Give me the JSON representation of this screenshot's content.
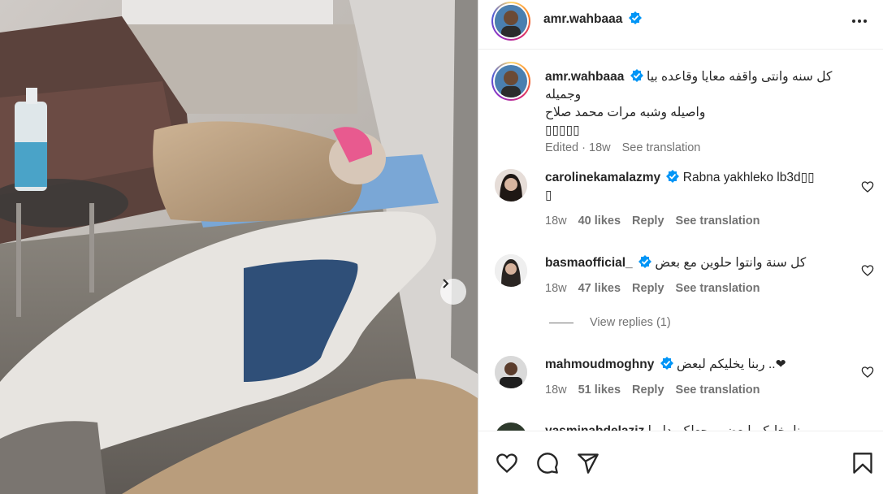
{
  "post": {
    "username": "amr.wahbaaa",
    "caption_line1": "كل سنه وانتى واقفه معايا وقاعده بيا وجميله",
    "caption_line2": "واصيله وشبه مرات محمد صلاح",
    "caption_line3": "▯▯▯▯▯",
    "edited_label": "Edited · 18w",
    "see_translation": "See translation"
  },
  "icons": {
    "more": "more-horizontal-icon",
    "verified": "verified-badge-icon",
    "next": "chevron-right-icon",
    "like": "heart-icon",
    "comment": "comment-icon",
    "share": "paper-plane-icon",
    "save": "bookmark-icon"
  },
  "colors": {
    "verified": "#0095f6",
    "muted": "#737373",
    "text": "#262626"
  },
  "comments": [
    {
      "username": "carolinekamalazmy",
      "text": "Rabna yakhleko lb3d▯▯",
      "text_cont": "▯",
      "age": "18w",
      "likes": "40 likes",
      "reply": "Reply",
      "translate": "See translation"
    },
    {
      "username": "basmaofficial_",
      "text": "كل سنة وانتوا حلوين مع بعض",
      "age": "18w",
      "likes": "47 likes",
      "reply": "Reply",
      "translate": "See translation"
    },
    {
      "username": "mahmoudmoghny",
      "text": "ربنا يخليكم لبعض ..❤",
      "age": "18w",
      "likes": "51 likes",
      "reply": "Reply",
      "translate": "See translation"
    },
    {
      "username": "yasminabdelaziz",
      "text": "ربنا يخليكم لبعض ويجعلكم دايما"
    }
  ],
  "view_replies": "View replies (1)"
}
